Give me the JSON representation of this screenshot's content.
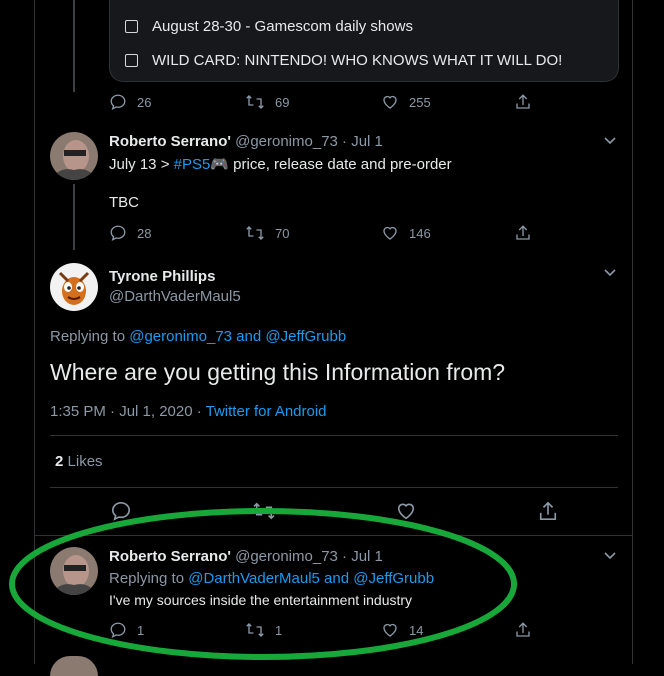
{
  "poll": {
    "options": [
      "August 28-30 - Gamescom daily shows",
      "WILD CARD: NINTENDO! WHO KNOWS WHAT IT WILL DO!"
    ]
  },
  "tweet1_actions": {
    "replies": "26",
    "retweets": "69",
    "likes": "255"
  },
  "tweet2": {
    "name": "Roberto Serrano'",
    "handle": "@geronimo_73 · Jul 1",
    "text_prefix": "July 13 > ",
    "hashtag": "#PS5",
    "emoji": "🎮",
    "text_suffix": " price, release date and pre-order",
    "text2": "TBC",
    "replies": "28",
    "retweets": "70",
    "likes": "146"
  },
  "main_tweet": {
    "name": "Tyrone Phillips",
    "handle": "@DarthVaderMaul5",
    "replying_prefix": "Replying to ",
    "replying_to": "@geronimo_73 and @JeffGrubb",
    "text": "Where are you getting this Information from?",
    "timestamp": "1:35 PM · Jul 1, 2020 · ",
    "source": "Twitter for Android",
    "likes_count": "2",
    "likes_label": "Likes"
  },
  "reply": {
    "name": "Roberto Serrano'",
    "handle": "@geronimo_73 · Jul 1",
    "replying_prefix": "Replying to ",
    "replying_to": "@DarthVaderMaul5 and @JeffGrubb",
    "text": "I've my sources inside the entertainment industry",
    "replies": "1",
    "retweets": "1",
    "likes": "14"
  },
  "colors": {
    "accent": "#1d9bf0",
    "highlight": "#18a83a",
    "background": "#000000"
  }
}
